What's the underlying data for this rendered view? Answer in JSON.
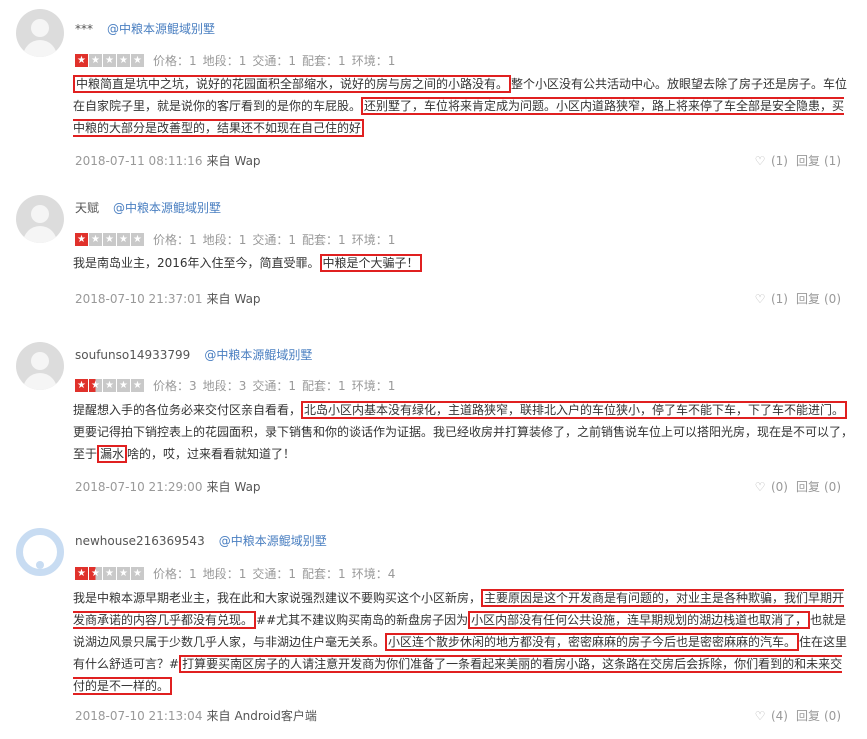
{
  "labels": {
    "price": "价格",
    "location": "地段",
    "traffic": "交通",
    "facilities": "配套",
    "environment": "环境",
    "from": "来自",
    "reply": "回复"
  },
  "colors": {
    "highlight_box": "#e02020",
    "star_on": "#e0312b",
    "star_off": "#c9c9c9",
    "link": "#4a7fc1"
  },
  "reviews": [
    {
      "user": "***",
      "house": "@中粮本源鲲域别墅",
      "stars": 1,
      "scores": {
        "price": "1",
        "location": "1",
        "traffic": "1",
        "facilities": "1",
        "environment": "1"
      },
      "segments": [
        {
          "text": "中粮简直是坑中之坑，说好的花园面积全部缩水，说好的房与房之间的小路没有。",
          "hl": true
        },
        {
          "text": "整个小区没有公共活动中心。放眼望去除了房子还是房子。车位在自家院子里，就是说你的客厅看到的是你的车屁股。",
          "hl": false
        },
        {
          "text": "还别墅了，车位将来肯定成为问题。小区内道路狭窄，路上将来停了车全部是安全隐患，买中粮的大部分是改善型的，结果还不如现在自己住的好",
          "hl": true
        }
      ],
      "datetime": "2018-07-11 08:11:16",
      "source": "Wap",
      "likes": "(1)",
      "replies": "(1)"
    },
    {
      "user": "天赋",
      "house": "@中粮本源鲲域别墅",
      "stars": 1,
      "scores": {
        "price": "1",
        "location": "1",
        "traffic": "1",
        "facilities": "1",
        "environment": "1"
      },
      "segments": [
        {
          "text": "我是南岛业主，2016年入住至今，简直受罪。",
          "hl": false
        },
        {
          "text": "中粮是个大骗子！",
          "hl": true
        }
      ],
      "datetime": "2018-07-10 21:37:01",
      "source": "Wap",
      "likes": "(1)",
      "replies": "(0)"
    },
    {
      "user": "soufunso14933799",
      "house": "@中粮本源鲲域别墅",
      "stars": 1.5,
      "scores": {
        "price": "3",
        "location": "3",
        "traffic": "1",
        "facilities": "1",
        "environment": "1"
      },
      "segments": [
        {
          "text": "提醒想入手的各位务必来交付区亲自看看，",
          "hl": false
        },
        {
          "text": "北岛小区内基本没有绿化，主道路狭窄，联排北入户的车位狭小，停了车不能下车，下了车不能进门。",
          "hl": true
        },
        {
          "text": "更要记得拍下销控表上的花园面积，录下销售和你的谈话作为证据。我已经收房并打算装修了，之前销售说车位上可以搭阳光房，现在是不可以了，至于",
          "hl": false
        },
        {
          "text": "漏水",
          "hl": true
        },
        {
          "text": "啥的，哎，过来看看就知道了！",
          "hl": false
        }
      ],
      "datetime": "2018-07-10 21:29:00",
      "source": "Wap",
      "likes": "(0)",
      "replies": "(0)"
    },
    {
      "user": "newhouse216369543",
      "house": "@中粮本源鲲域别墅",
      "stars": 1.5,
      "scores": {
        "price": "1",
        "location": "1",
        "traffic": "1",
        "facilities": "1",
        "environment": "4"
      },
      "segments": [
        {
          "text": "我是中粮本源早期老业主，我在此和大家说强烈建议不要购买这个小区新房，",
          "hl": false
        },
        {
          "text": "主要原因是这个开发商是有问题的，对业主是各种欺骗，我们早期开发商承诺的内容几乎都没有兑现。",
          "hl": true
        },
        {
          "text": "##尤其不建议购买南岛的新盘房子因为",
          "hl": false
        },
        {
          "text": "小区内部没有任何公共设施，连早期规划的湖边栈道也取消了，",
          "hl": true
        },
        {
          "text": "也就是说湖边风景只属于少数几乎人家，与非湖边住户毫无关系。",
          "hl": false
        },
        {
          "text": "小区连个散步休闲的地方都没有，密密麻麻的房子今后也是密密麻麻的汽车。",
          "hl": true
        },
        {
          "text": "住在这里有什么舒适可言？#",
          "hl": false
        },
        {
          "text": "打算要买南区房子的人请注意开发商为你们准备了一条看起来美丽的看房小路，这条路在交房后会拆除，你们看到的和未来交付的是不一样的。",
          "hl": true
        }
      ],
      "datetime": "2018-07-10 21:13:04",
      "source": "Android客户端",
      "likes": "(4)",
      "replies": "(0)"
    }
  ]
}
